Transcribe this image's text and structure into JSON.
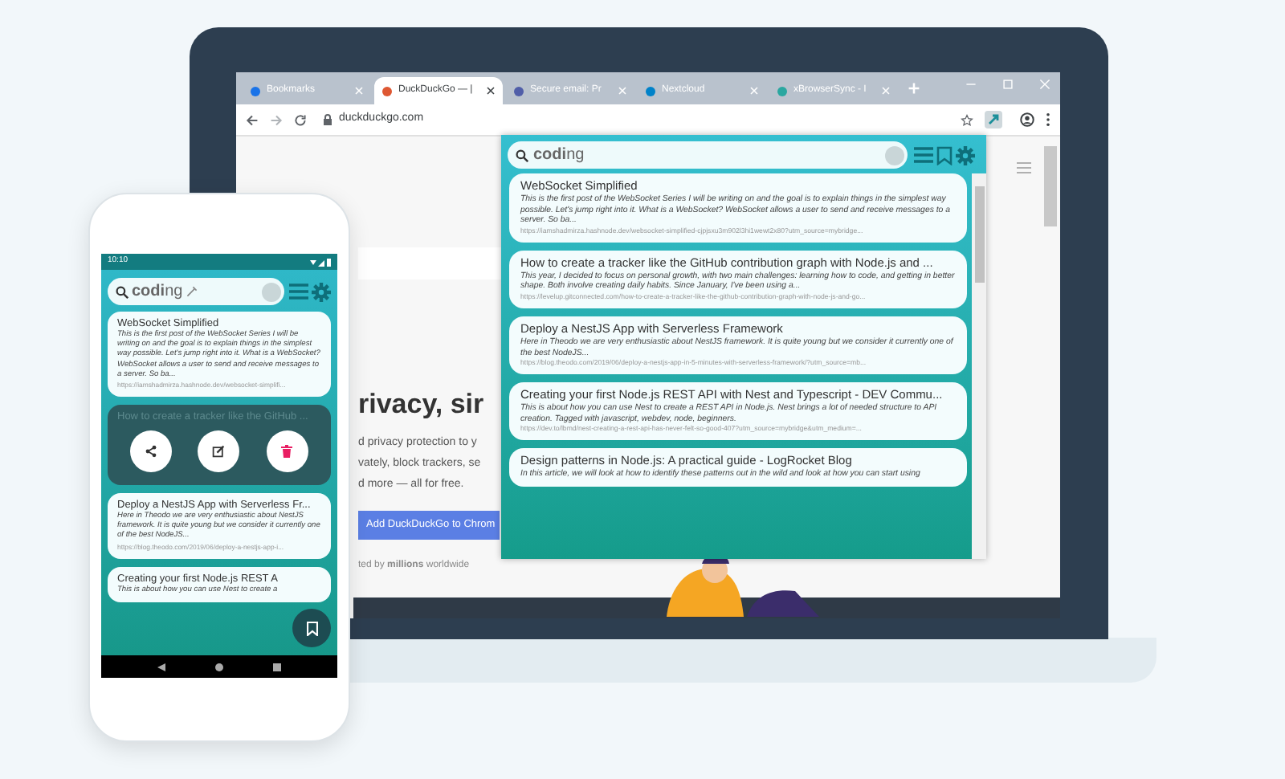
{
  "browser": {
    "tabs": [
      {
        "label": "Bookmarks",
        "selected": false,
        "color": "#1a73e8"
      },
      {
        "label": "DuckDuckGo — |",
        "selected": true,
        "color": "#de5833"
      },
      {
        "label": "Secure email: Pr",
        "selected": false,
        "color": "#505ea8"
      },
      {
        "label": "Nextcloud",
        "selected": false,
        "color": "#0082c9"
      },
      {
        "label": "xBrowserSync - I",
        "selected": false,
        "color": "#2aa7a0"
      }
    ],
    "address": "duckduckgo.com"
  },
  "page": {
    "heading": "rivacy, sir",
    "lines": [
      "d privacy protection to y",
      "vately, block trackers, se",
      "d more — all for free."
    ],
    "button": "Add DuckDuckGo to Chrom",
    "footnote": "ted by **millions** worldwide"
  },
  "popup": {
    "search": {
      "value": "**codi**ng"
    },
    "results": [
      {
        "title": "WebSocket Simplified",
        "description": "This is the first post of the WebSocket Series I will be writing on and the goal is to explain things in the simplest way possible. Let's jump right into it. What is a WebSocket? WebSocket allows a user to send and receive messages to a server. So ba...",
        "url": "https://iamshadmirza.hashnode.dev/websocket-simplified-cjpjsxu3m902l3hi1wewt2x80?utm_source=mybridge..."
      },
      {
        "title": "How to create a tracker like the GitHub contribution graph with Node.js and ...",
        "description": "This year, I decided to focus on personal growth, with two main challenges: learning how to code, and getting in better shape. Both involve creating daily habits. Since January, I've been using a...",
        "url": "https://levelup.gitconnected.com/how-to-create-a-tracker-like-the-github-contribution-graph-with-node-js-and-go..."
      },
      {
        "title": "Deploy a NestJS App with Serverless Framework",
        "description": "Here in Theodo we are very enthusiastic about NestJS framework. It is quite young but we consider it currently one of the best NodeJS...",
        "url": "https://blog.theodo.com/2019/06/deploy-a-nestjs-app-in-5-minutes-with-serverless-framework/?utm_source=mb..."
      },
      {
        "title": "Creating your first Node.js REST API with Nest and Typescript - DEV Commu...",
        "description": "This is about how you can use Nest to create a REST API in Node.js. Nest brings a lot of needed structure to API creation. Tagged with javascript, webdev, node, beginners.",
        "url": "https://dev.to/lbmd/nest-creating-a-rest-api-has-never-felt-so-good-407?utm_source=mybridge&utm_medium=..."
      },
      {
        "title": "Design patterns in Node.js: A practical guide - LogRocket Blog",
        "description": "In this article, we will look at how to identify these patterns out in the wild and look at how you can start using"
      }
    ]
  },
  "phone": {
    "time": "10:10",
    "search": {
      "value": "**codi**ng"
    },
    "cards": [
      {
        "kind": "result",
        "title": "WebSocket Simplified",
        "description": "This is the first post of the WebSocket Series I will be writing on and the goal is to explain things in the simplest way possible. Let's jump right into it. What is a WebSocket? WebSocket allows a user to send and receive messages to a server. So ba...",
        "url": "https://iamshadmirza.hashnode.dev/websocket-simplifi..."
      },
      {
        "kind": "actions",
        "title": "How to create a tracker like the GitHub ..."
      },
      {
        "kind": "result",
        "title": "Deploy a NestJS App with Serverless Fr...",
        "description": "Here in Theodo we are very enthusiastic about NestJS framework. It is quite young but we consider it currently one of the best NodeJS...",
        "url": "https://blog.theodo.com/2019/06/deploy-a-nestjs-app-i..."
      },
      {
        "kind": "result",
        "title": "Creating your first Node.js REST A",
        "description": "This is about how you can use Nest to create a"
      }
    ]
  }
}
